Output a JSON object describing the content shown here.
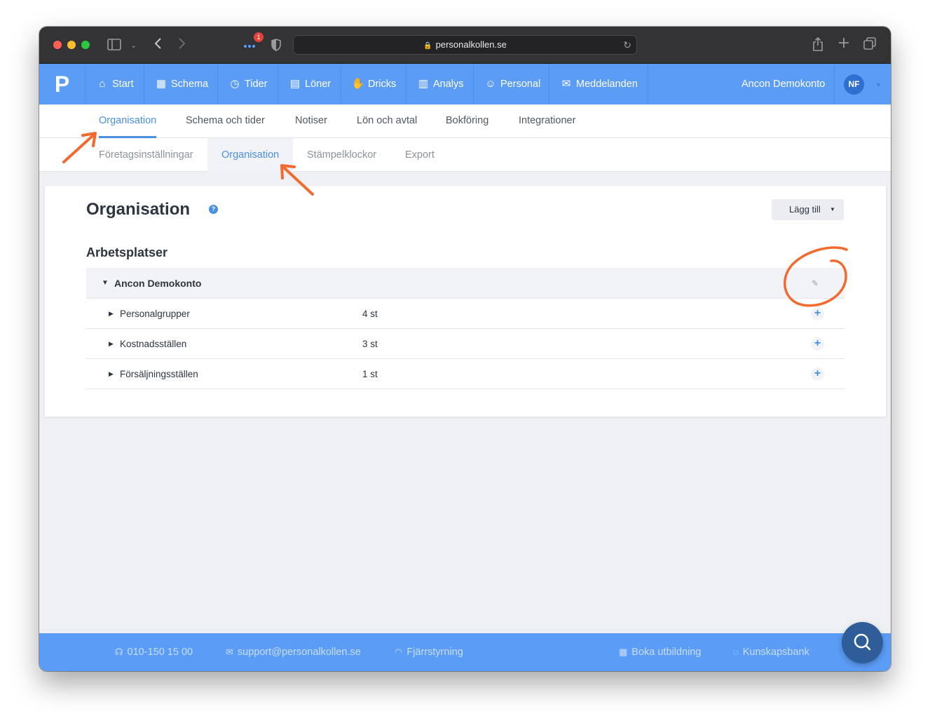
{
  "browser": {
    "url": "personalkollen.se",
    "notification_count": "1"
  },
  "app": {
    "logo": "P",
    "nav": [
      {
        "label": "Start",
        "icon": "home-icon"
      },
      {
        "label": "Schema",
        "icon": "calendar-icon"
      },
      {
        "label": "Tider",
        "icon": "clock-icon"
      },
      {
        "label": "Löner",
        "icon": "document-icon"
      },
      {
        "label": "Dricks",
        "icon": "tip-hand-icon"
      },
      {
        "label": "Analys",
        "icon": "bar-chart-icon"
      },
      {
        "label": "Personal",
        "icon": "person-icon"
      },
      {
        "label": "Meddelanden",
        "icon": "envelope-icon"
      }
    ],
    "account_name": "Ancon Demokonto",
    "avatar_initials": "NF"
  },
  "tabs_primary": [
    "Organisation",
    "Schema och tider",
    "Notiser",
    "Lön och avtal",
    "Bokföring",
    "Integrationer"
  ],
  "tabs_secondary": [
    "Företagsinställningar",
    "Organisation",
    "Stämpelklockor",
    "Export"
  ],
  "main": {
    "title": "Organisation",
    "help_symbol": "?",
    "add_button": "Lägg till",
    "section_title": "Arbetsplatser",
    "root": {
      "label": "Ancon Demokonto"
    },
    "rows": [
      {
        "label": "Personalgrupper",
        "count": "4 st"
      },
      {
        "label": "Kostnadsställen",
        "count": "3 st"
      },
      {
        "label": "Försäljningsställen",
        "count": "1 st"
      }
    ]
  },
  "footer": {
    "phone": "010-150 15 00",
    "email": "support@personalkollen.se",
    "remote": "Fjärrstyrning",
    "training": "Boka utbildning",
    "knowledge": "Kunskapsbank"
  },
  "colors": {
    "brand_blue": "#5b9cf6",
    "accent": "#4a90e2",
    "annotation_orange": "#f26a2e"
  }
}
